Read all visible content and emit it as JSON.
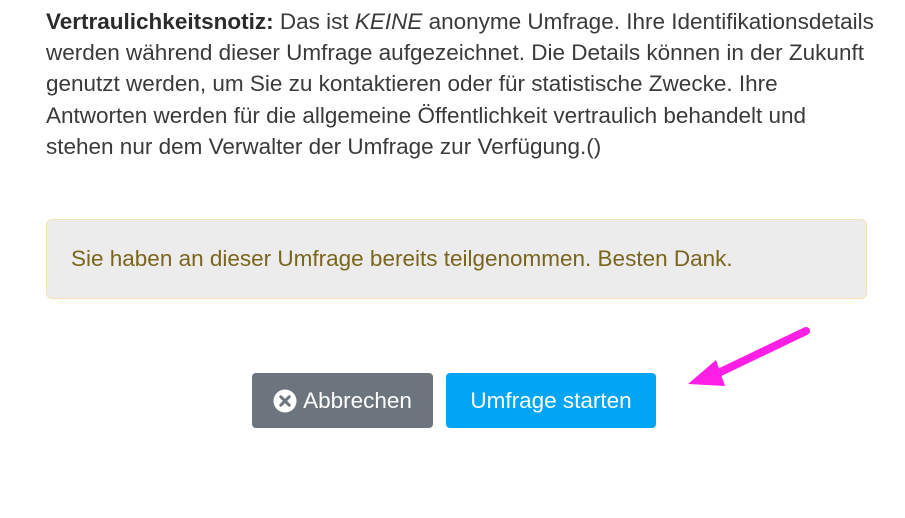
{
  "notice": {
    "label": "Vertraulichkeitsnotiz:",
    "text_before": " Das ist ",
    "emphasis": "KEINE",
    "text_after": " anonyme Umfrage. Ihre Identifikationsdetails werden während dieser Umfrage aufgezeichnet. Die Details können in der Zukunft genutzt werden, um Sie zu kontaktieren oder für statistische Zwecke. Ihre Antworten werden für die allgemeine Öffentlichkeit vertraulich behandelt und stehen nur dem Verwalter der Umfrage zur Verfügung.()"
  },
  "alert": {
    "message": "Sie haben an dieser Umfrage bereits teilgenommen. Besten Dank."
  },
  "buttons": {
    "cancel_label": "Abbrechen",
    "cancel_icon": "times-circle-icon",
    "start_label": "Umfrage starten"
  },
  "colors": {
    "text": "#3a3a3a",
    "alert_bg": "#ececec",
    "alert_border": "#f6e2b0",
    "alert_text": "#7a651e",
    "cancel_bg": "#6c757d",
    "start_bg": "#00a5f5",
    "annotation_arrow": "#ff1ee6"
  }
}
